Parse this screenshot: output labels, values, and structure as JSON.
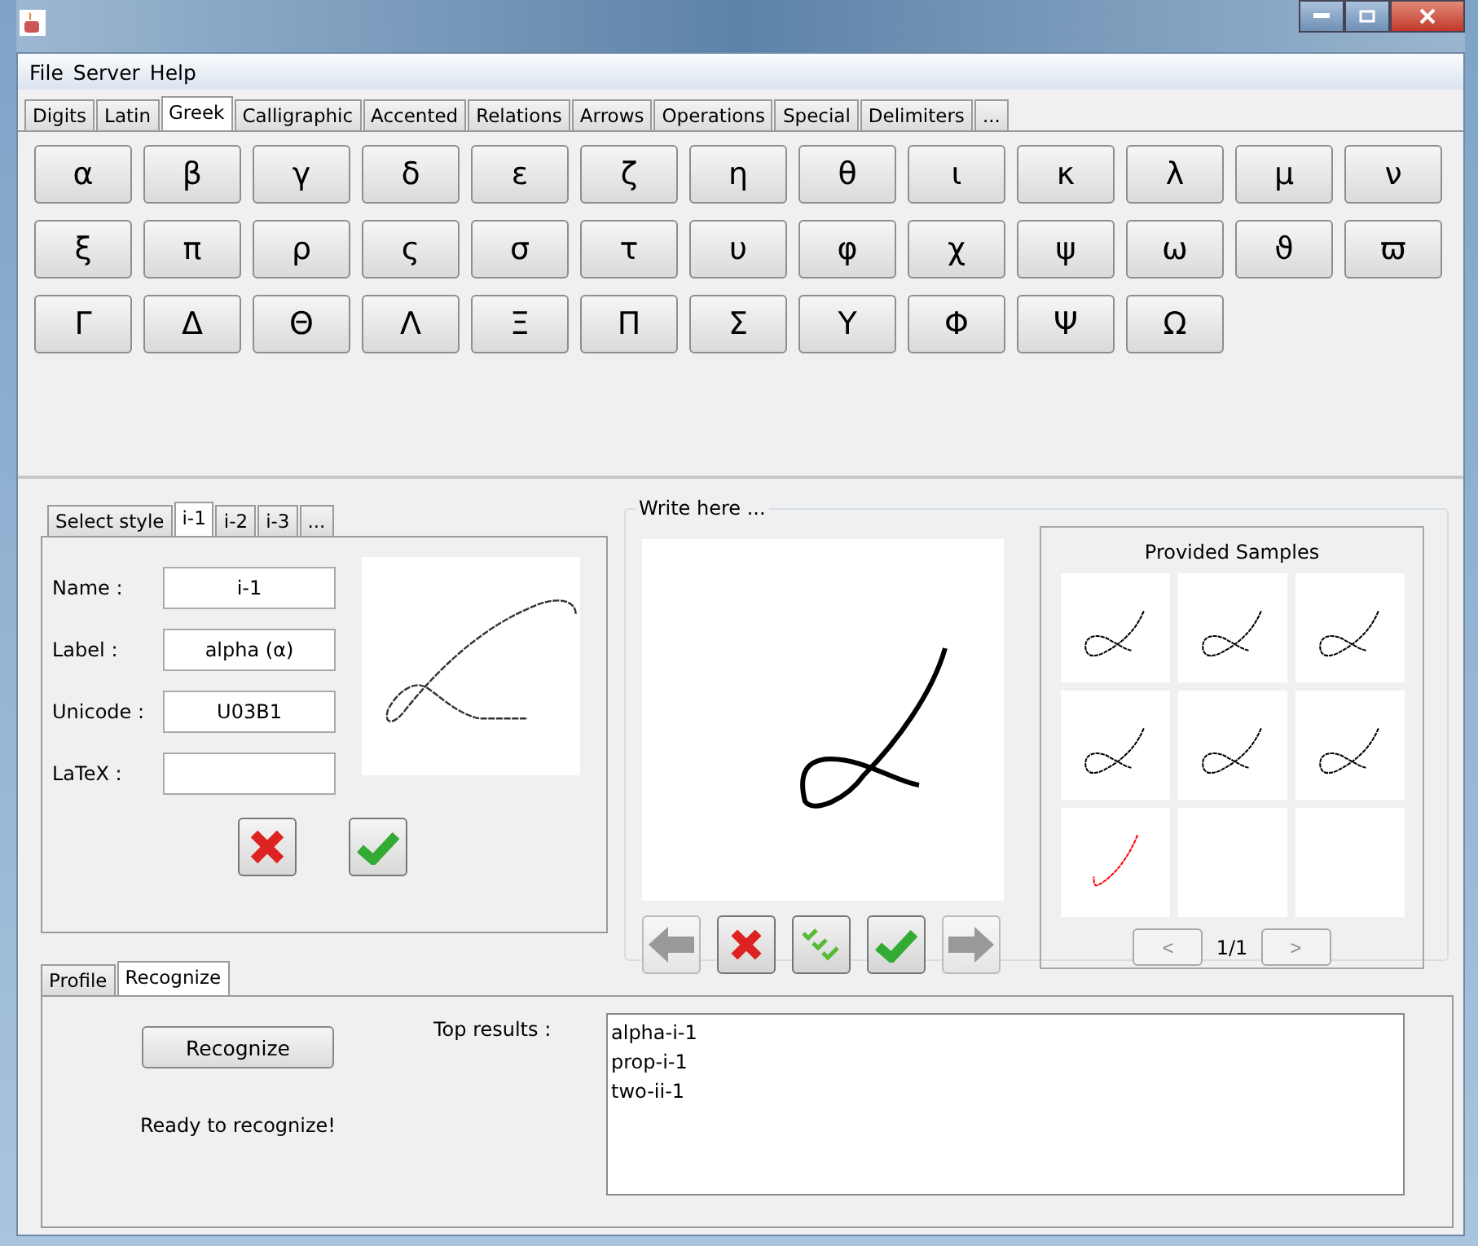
{
  "menu": [
    "File",
    "Server",
    "Help"
  ],
  "symbol_tabs": [
    {
      "label": "Digits",
      "selected": false
    },
    {
      "label": "Latin",
      "selected": false
    },
    {
      "label": "Greek",
      "selected": true
    },
    {
      "label": "Calligraphic",
      "selected": false
    },
    {
      "label": "Accented",
      "selected": false
    },
    {
      "label": "Relations",
      "selected": false
    },
    {
      "label": "Arrows",
      "selected": false
    },
    {
      "label": "Operations",
      "selected": false
    },
    {
      "label": "Special",
      "selected": false
    },
    {
      "label": "Delimiters",
      "selected": false
    },
    {
      "label": "...",
      "selected": false
    }
  ],
  "symbols": [
    "α",
    "β",
    "γ",
    "δ",
    "ε",
    "ζ",
    "η",
    "θ",
    "ι",
    "κ",
    "λ",
    "μ",
    "ν",
    "ξ",
    "π",
    "ρ",
    "ς",
    "σ",
    "τ",
    "υ",
    "φ",
    "χ",
    "ψ",
    "ω",
    "ϑ",
    "ϖ",
    "Γ",
    "Δ",
    "Θ",
    "Λ",
    "Ξ",
    "Π",
    "Σ",
    "Υ",
    "Φ",
    "Ψ",
    "Ω"
  ],
  "style_tabs": [
    {
      "label": "Select style",
      "selected": false
    },
    {
      "label": "i-1",
      "selected": true
    },
    {
      "label": "i-2",
      "selected": false
    },
    {
      "label": "i-3",
      "selected": false
    },
    {
      "label": "...",
      "selected": false
    }
  ],
  "style_form": [
    {
      "label": "Name :",
      "value": "i-1"
    },
    {
      "label": "Label :",
      "value": "alpha (α)"
    },
    {
      "label": "Unicode :",
      "value": "U03B1"
    },
    {
      "label": "LaTeX :"
    }
  ],
  "write_panel": {
    "title": "Write here ...",
    "samples_title": "Provided Samples",
    "samples": [
      {
        "kind": "stroke",
        "color": "#000000"
      },
      {
        "kind": "stroke",
        "color": "#000000"
      },
      {
        "kind": "stroke",
        "color": "#000000"
      },
      {
        "kind": "stroke",
        "color": "#000000"
      },
      {
        "kind": "stroke",
        "color": "#000000"
      },
      {
        "kind": "stroke",
        "color": "#000000"
      },
      {
        "kind": "stroke",
        "color": "#ff0000"
      },
      {
        "kind": "empty"
      },
      {
        "kind": "empty"
      }
    ],
    "prev": "<",
    "page": "1/1",
    "next": ">"
  },
  "bottom_tabs": [
    {
      "label": "Profile",
      "selected": false
    },
    {
      "label": "Recognize",
      "selected": true
    }
  ],
  "recognize": {
    "button": "Recognize",
    "status": "Ready to recognize!",
    "results_label": "Top results :",
    "results": [
      "alpha-i-1",
      "prop-i-1",
      "two-ii-1"
    ]
  }
}
